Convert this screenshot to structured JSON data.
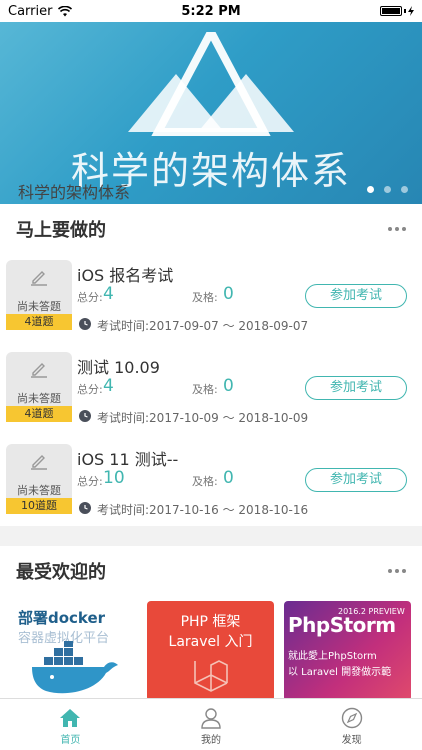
{
  "status_bar": {
    "carrier": "Carrier",
    "time": "5:22 PM",
    "battery_level": 1.0
  },
  "banner": {
    "main_title": "科学的架构体系",
    "caption": "科学的架构体系",
    "page_count": 3,
    "active_page": 0
  },
  "todo": {
    "title": "马上要做的",
    "score_label": "总分:",
    "pass_label": "及格:",
    "status_text": "尚未答题",
    "join_label": "参加考试",
    "time_prefix": "考试时间:",
    "items": [
      {
        "name": "iOS 报名考试",
        "score": "4",
        "pass": "0",
        "count": "4道题",
        "time_range": "2017-09-07 ～ 2018-09-07"
      },
      {
        "name": "测试 10.09",
        "score": "4",
        "pass": "0",
        "count": "4道题",
        "time_range": "2017-10-09 ～ 2018-10-09"
      },
      {
        "name": "iOS 11 测试--",
        "score": "10",
        "pass": "0",
        "count": "10道题",
        "time_range": "2017-10-16 ～ 2018-10-16"
      }
    ]
  },
  "popular": {
    "title": "最受欢迎的",
    "courses": [
      {
        "title": "部署docker",
        "subtitle": "容器虚拟化平台"
      },
      {
        "title": "PHP 框架",
        "subtitle": "Laravel 入门"
      },
      {
        "title": "PhpStorm",
        "badge": "2016.2 PREVIEW",
        "line1": "就此愛上PhpStorm",
        "line2": "以 Laravel 開發做示範"
      }
    ]
  },
  "tabs": [
    {
      "label": "首页",
      "icon": "home-icon",
      "active": true
    },
    {
      "label": "我的",
      "icon": "user-icon",
      "active": false
    },
    {
      "label": "发现",
      "icon": "compass-icon",
      "active": false
    }
  ],
  "colors": {
    "accent": "#41b6b0",
    "badge": "#f7c631",
    "php_card": "#e8493a"
  }
}
